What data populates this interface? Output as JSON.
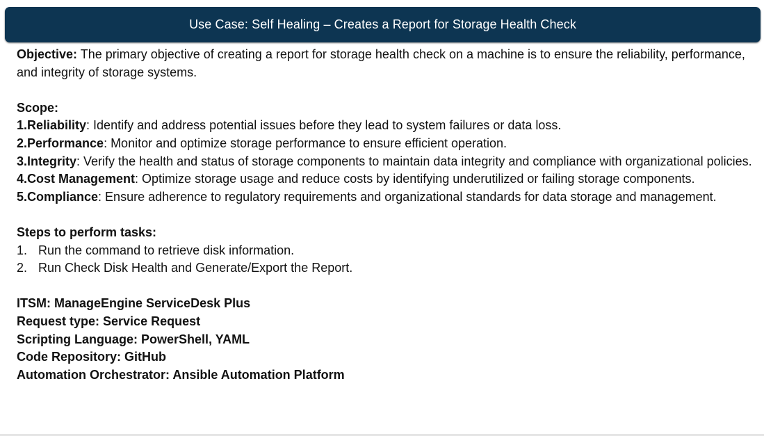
{
  "header": {
    "title": "Use Case: Self Healing – Creates a Report for Storage Health Check"
  },
  "objective": {
    "label": "Objective:",
    "text": "  The primary objective of creating a report for storage health check on a machine is to ensure the reliability, performance, and integrity of storage systems."
  },
  "scope": {
    "heading": "Scope:",
    "items": [
      {
        "label": "1.Reliability",
        "text": ": Identify and address potential issues before they lead to system failures or data loss."
      },
      {
        "label": "2.Performance",
        "text": ": Monitor and optimize storage performance to ensure efficient operation."
      },
      {
        "label": "3.Integrity",
        "text": ": Verify the health and status of storage components to maintain data integrity and compliance with organizational policies."
      },
      {
        "label": "4.Cost Management",
        "text": ": Optimize storage usage and reduce costs by identifying underutilized or failing storage components."
      },
      {
        "label": "5.Compliance",
        "text": ": Ensure adherence to regulatory requirements and organizational standards for data storage and management."
      }
    ]
  },
  "steps": {
    "heading": "Steps to perform tasks:",
    "items": [
      {
        "num": "1.",
        "text": "Run the command to retrieve disk information."
      },
      {
        "num": "2.",
        "text": "Run Check Disk Health and Generate/Export the Report."
      }
    ]
  },
  "details": [
    "ITSM: ManageEngine ServiceDesk Plus",
    "Request type: Service Request",
    "Scripting Language: PowerShell, YAML",
    "Code Repository: GitHub",
    "Automation Orchestrator: Ansible Automation Platform"
  ]
}
